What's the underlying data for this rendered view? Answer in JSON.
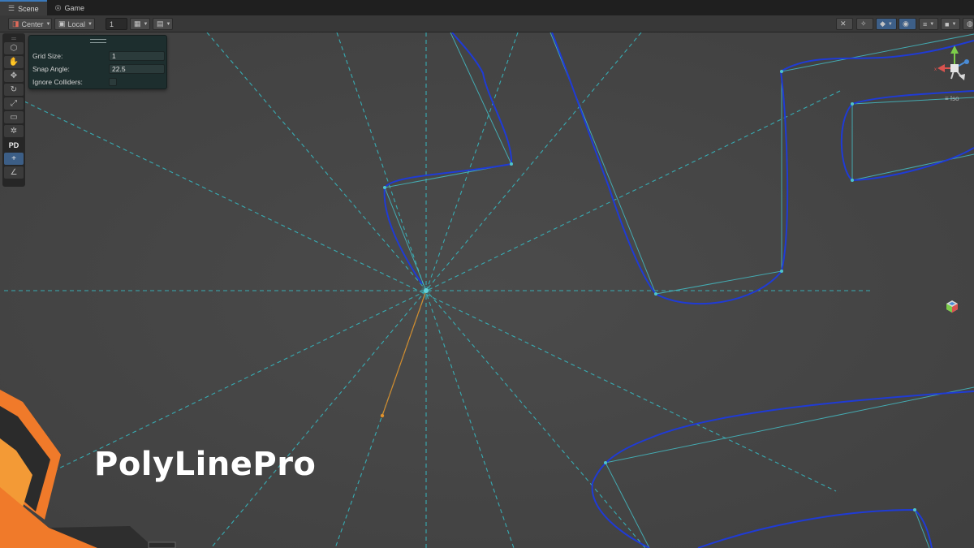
{
  "tabs": [
    {
      "label": "Scene",
      "icon": "hamburger-icon",
      "active": true
    },
    {
      "label": "Game",
      "icon": "gamepad-icon",
      "active": false
    }
  ],
  "toolbar": {
    "pivot_mode": "Center",
    "pivot_rotation": "Local",
    "grid_increment": "1"
  },
  "toolstrip": {
    "plugin_label": "PD",
    "tools": [
      "view-tool",
      "move-tool",
      "rotate-tool",
      "scale-tool",
      "rect-tool",
      "transform-tool",
      "custom-tool"
    ]
  },
  "panel": {
    "grid_size_label": "Grid Size:",
    "grid_size_value": "1",
    "snap_angle_label": "Snap Angle:",
    "snap_angle_value": "22.5",
    "ignore_colliders_label": "Ignore Colliders:",
    "ignore_colliders_checked": false
  },
  "gizmo": {
    "projection_label": "Iso"
  },
  "overlay_title": "PolyLinePro",
  "colors": {
    "guide_line": "#36b7bf",
    "polyline": "#1f3bd6",
    "preview_segment": "#d58a2a",
    "accent_orange": "#f07a2a"
  }
}
